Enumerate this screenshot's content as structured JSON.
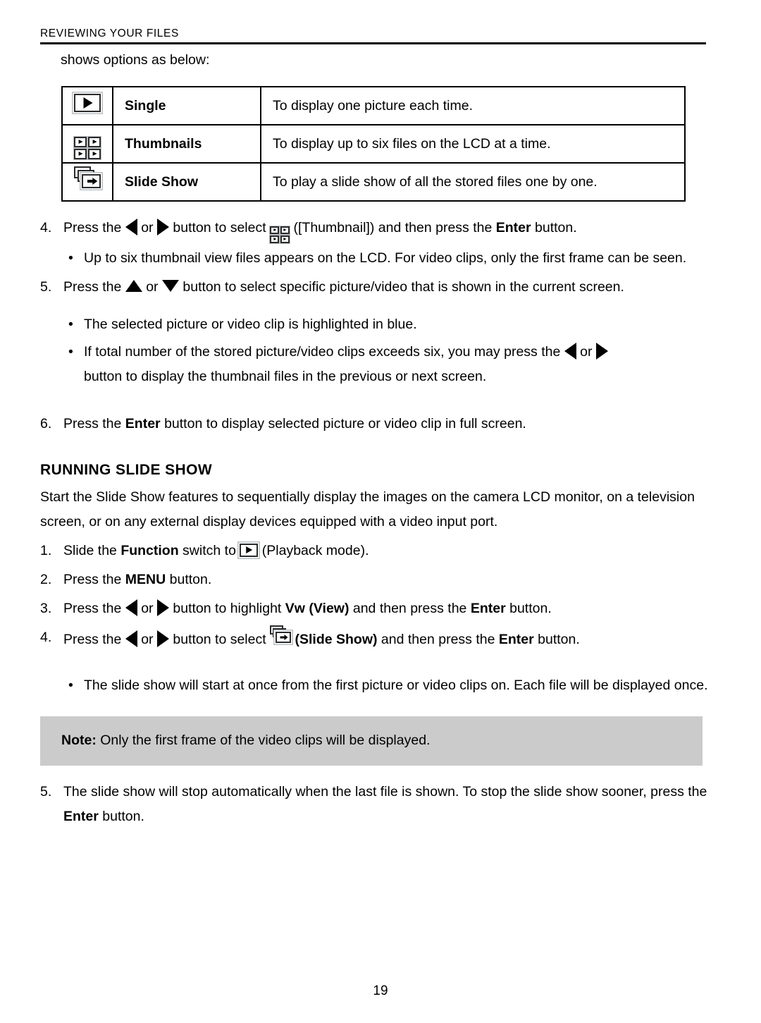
{
  "header": {
    "running_title": "REVIEWING YOUR FILES"
  },
  "intro": {
    "line": "shows options as below:"
  },
  "options_table": {
    "rows": [
      {
        "icon": "single-view-icon",
        "name": "Single",
        "description": "To display one picture each time."
      },
      {
        "icon": "thumbnails-view-icon",
        "name": "Thumbnails",
        "description": "To display up to six files on the LCD at a time."
      },
      {
        "icon": "slide-show-icon",
        "name": "Slide Show",
        "description": "To play a slide show of all the stored files one by one."
      }
    ]
  },
  "reviewing_steps": {
    "step4": {
      "num": "4.",
      "t1": "Press the ",
      "left_icon": "left-arrow-icon",
      "t2": " or ",
      "right_icon": "right-arrow-icon",
      "t3": " button to select ",
      "inline_icon": "thumbnails-view-icon",
      "t4": " ([Thumbnail]) and then press the ",
      "bold": "Enter",
      "t5": " button."
    },
    "bullet1": "Up to six thumbnail view files appears on the LCD. For video clips, only the first frame can be seen.",
    "step5": {
      "num": "5.",
      "t1": "Press the ",
      "up_icon": "up-arrow-icon",
      "t2": " or ",
      "down_icon": "down-arrow-icon",
      "t3": " button to select specific picture/video that is shown in the current screen."
    },
    "bullet2": "The selected picture or video clip is highlighted in blue.",
    "bullet3": {
      "t1": "If total number of the stored picture/video clips exceeds six, you may press the ",
      "left_icon": "left-arrow-icon",
      "t2": " or ",
      "right_icon": "right-arrow-icon",
      "t3": "button to display the thumbnail files in the previous or next screen."
    },
    "step6": {
      "num": "6.",
      "t1": "Press the ",
      "bold": "Enter",
      "t2": " button to display selected picture or video clip in full screen."
    }
  },
  "slide_show_section": {
    "title": "RUNNING SLIDE SHOW",
    "intro": "Start the Slide Show features to sequentially display the images on the camera LCD monitor, on a television screen, or on any external display devices equipped with a video input port.",
    "step1": {
      "num": "1.",
      "t1": "Slide the ",
      "bold": "Function",
      "t2": " switch to ",
      "inline_icon": "playback-mode-icon",
      "t3": " (Playback mode)."
    },
    "step2": {
      "num": "2.",
      "t1": "Press the ",
      "bold": "MENU",
      "t2": " button."
    },
    "step3": {
      "num": "3.",
      "t1": "Press the ",
      "left_icon": "left-arrow-icon",
      "t2": " or ",
      "right_icon": "right-arrow-icon",
      "t3": " button to highlight ",
      "bold1": "Vw (View)",
      "t4": " and then press the ",
      "bold2": "Enter",
      "t5": " button."
    },
    "step4": {
      "num": "4.",
      "t1": "Press the ",
      "left_icon": "left-arrow-icon",
      "t2": " or ",
      "right_icon": "right-arrow-icon",
      "t3": " button to select ",
      "inline_icon": "slide-show-icon",
      "bold1": " (Slide Show)",
      "t4": " and then press the ",
      "bold2": "Enter",
      "t5": " button."
    },
    "bullet1": "The slide show will start at once from the first picture or video clips on. Each file will be displayed once.",
    "note": {
      "label": "Note:",
      "text": " Only the first frame of the video clips will be displayed.",
      "background": "#cbcbcb"
    },
    "step5": {
      "num": "5.",
      "t1": "The slide show will stop automatically when the last file is shown. To stop the slide show sooner, press the ",
      "bold": "Enter",
      "t2": " button."
    }
  },
  "footer": {
    "page_number": "19"
  },
  "bullet_glyph": "•"
}
